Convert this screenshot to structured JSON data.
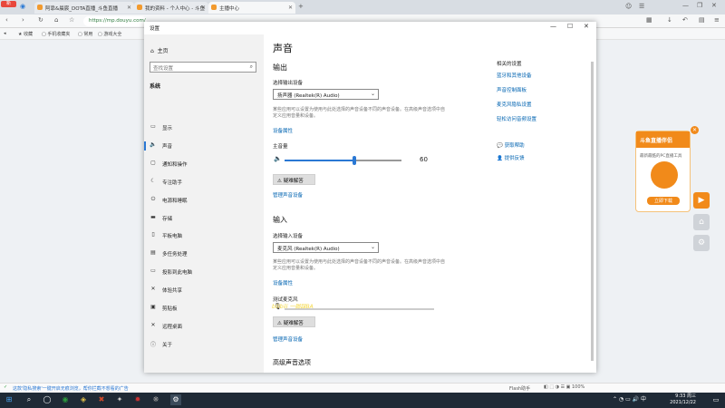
{
  "browser": {
    "tabs": [
      {
        "label": "阿靠&晨宸_DOTA直播_斗鱼直播",
        "color": "#f29a2e"
      },
      {
        "label": "我的资料 - 个人中心 - 斗鱼",
        "color": "#f29a2e"
      },
      {
        "label": "主播中心",
        "color": "#f29a2e"
      }
    ],
    "corner_badge": "新",
    "url": "https://mp.douyu.com/",
    "bookmarks": [
      "收藏",
      "手机收藏夹",
      "常用",
      "游戏大全"
    ]
  },
  "window": {
    "title": "设置",
    "controls": {
      "minimize": "—",
      "maximize": "☐",
      "close": "✕"
    }
  },
  "sidebar": {
    "home": "主页",
    "search_placeholder": "查找设置",
    "category": "系统",
    "items": [
      {
        "label": "显示",
        "icon": "display-icon",
        "glyph": "▭"
      },
      {
        "label": "声音",
        "icon": "speaker-icon",
        "glyph": "🔈"
      },
      {
        "label": "通知和操作",
        "icon": "notification-icon",
        "glyph": "▢"
      },
      {
        "label": "专注助手",
        "icon": "moon-icon",
        "glyph": "☾"
      },
      {
        "label": "电源和睡眠",
        "icon": "power-icon",
        "glyph": "⏻"
      },
      {
        "label": "存储",
        "icon": "storage-icon",
        "glyph": "▬"
      },
      {
        "label": "平板电脑",
        "icon": "tablet-icon",
        "glyph": "▯"
      },
      {
        "label": "多任务处理",
        "icon": "multitask-icon",
        "glyph": "▤"
      },
      {
        "label": "投影到此电脑",
        "icon": "project-icon",
        "glyph": "▭"
      },
      {
        "label": "体验共享",
        "icon": "share-icon",
        "glyph": "✕"
      },
      {
        "label": "剪贴板",
        "icon": "clipboard-icon",
        "glyph": "▣"
      },
      {
        "label": "远程桌面",
        "icon": "remote-icon",
        "glyph": "✕"
      },
      {
        "label": "关于",
        "icon": "info-icon",
        "glyph": "ⓘ"
      }
    ],
    "active_index": 1
  },
  "main": {
    "title": "声音",
    "output": {
      "heading": "输出",
      "device_label": "选择输出设备",
      "device_value": "扬声器 (Realtek(R) Audio)",
      "description": "某些应用可以设置为使用与此处选择的声音设备不同的声音设备。在高级声音选项中自定义应用音量和设备。",
      "properties_link": "设备属性",
      "volume_label": "主音量",
      "volume_value": 60,
      "volume_text": "60",
      "troubleshoot": "疑难解答",
      "manage_link": "管理声音设备"
    },
    "input": {
      "heading": "输入",
      "device_label": "选择输入设备",
      "device_value": "麦克风 (Realtek(R) Audio)",
      "description": "某些应用可以设置为使用与此处选择的声音设备不同的声音设备。在高级声音选项中自定义应用音量和设备。",
      "properties_link": "设备属性",
      "test_label": "测试麦克风",
      "mic_level": 0,
      "troubleshoot": "疑难解答",
      "manage_link": "管理声音设备"
    },
    "advanced_heading": "高级声音选项",
    "related": {
      "title": "相关的设置",
      "links": [
        "蓝牙和其他设备",
        "声音控制面板",
        "麦克风隐私设置",
        "轻松访问音频设置"
      ]
    },
    "help": {
      "get_help": "获取帮助",
      "feedback": "提供反馈"
    }
  },
  "promo": {
    "title": "斗鱼直播伴侣",
    "subtitle": "最新最酷的PC直播工具",
    "button": "立即下载",
    "close": "✕"
  },
  "page_status": "这款'隐私搜索'一键开启无痕浏览，帮你拦截不想看的广告",
  "taskbar": {
    "time": "9:33 周三",
    "date": "2021/12/22",
    "flash_label": "Flash助手"
  },
  "watermark": "bilibili 一脚踩BA"
}
